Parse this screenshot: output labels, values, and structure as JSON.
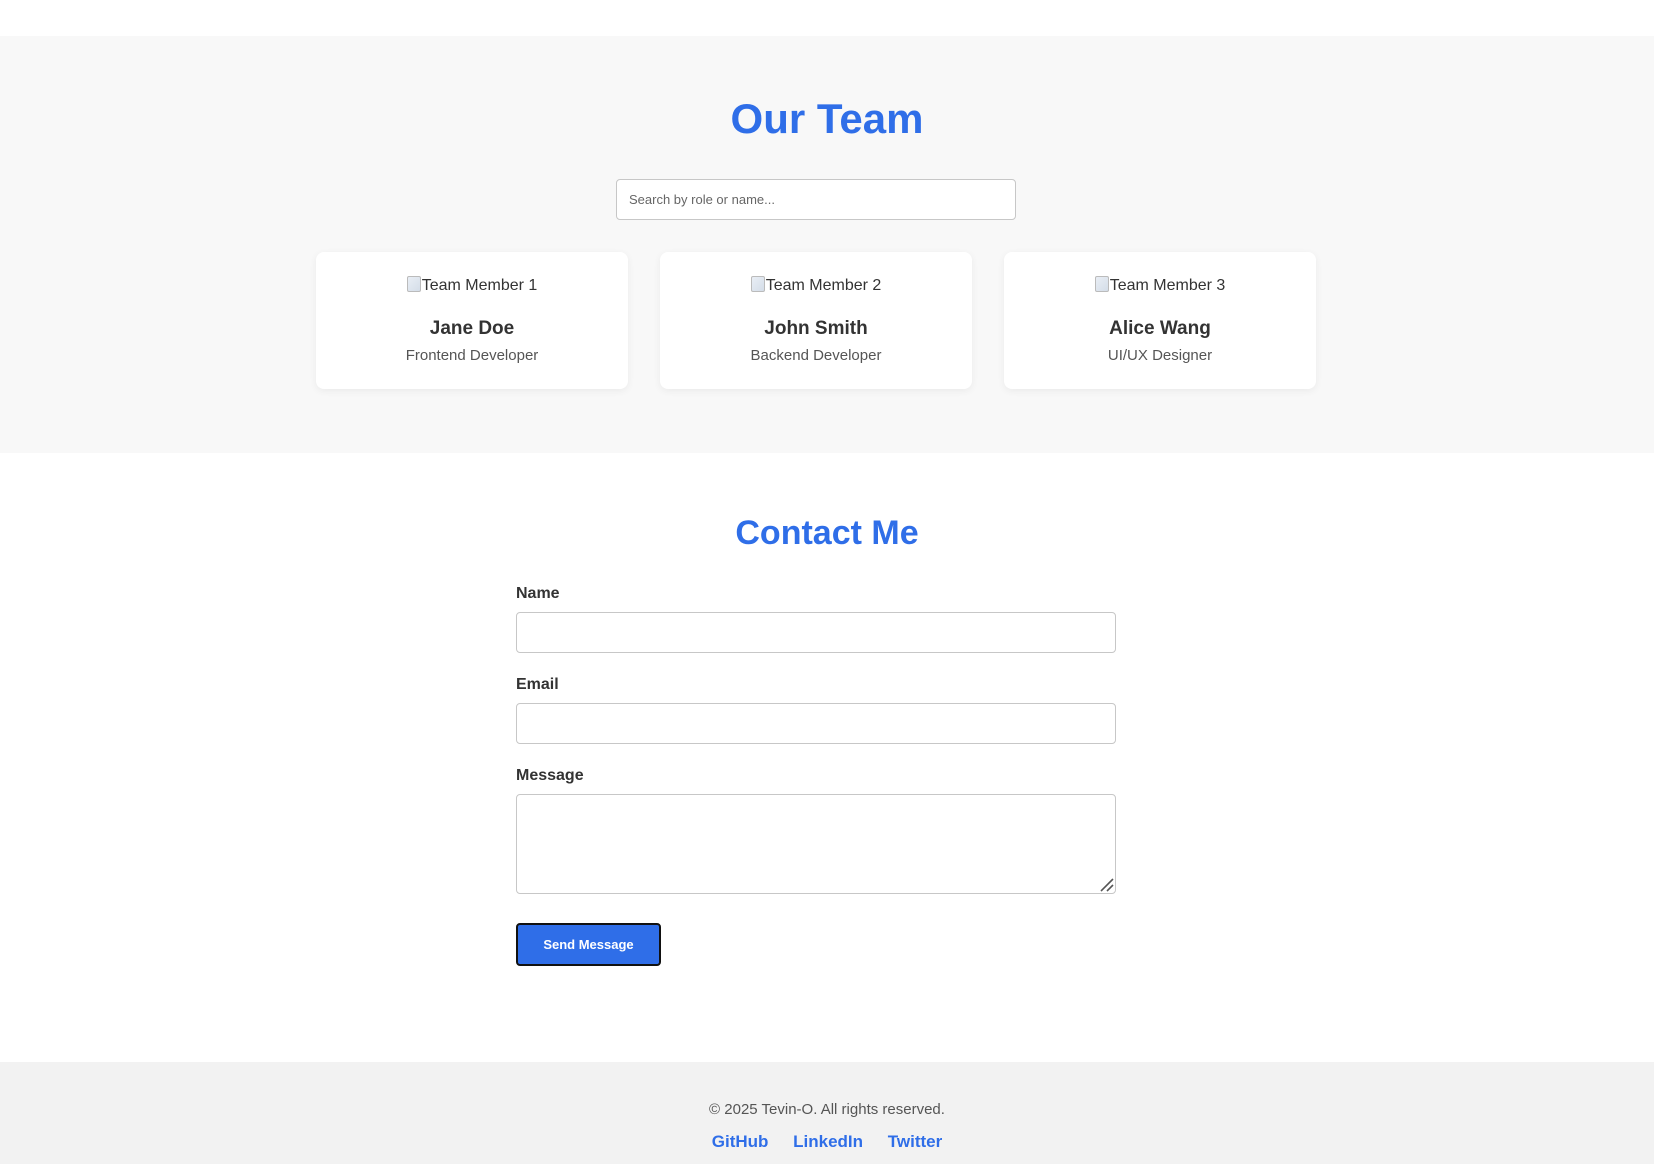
{
  "team": {
    "title": "Our Team",
    "search_placeholder": "Search by role or name...",
    "members": [
      {
        "image_alt": "Team Member 1",
        "name": "Jane Doe",
        "role": "Frontend Developer"
      },
      {
        "image_alt": "Team Member 2",
        "name": "John Smith",
        "role": "Backend Developer"
      },
      {
        "image_alt": "Team Member 3",
        "name": "Alice Wang",
        "role": "UI/UX Designer"
      }
    ]
  },
  "contact": {
    "title": "Contact Me",
    "name_label": "Name",
    "name_value": "",
    "email_label": "Email",
    "email_value": "",
    "message_label": "Message",
    "message_value": "",
    "submit_label": "Send Message"
  },
  "footer": {
    "copyright": "© 2025 Tevin-O. All rights reserved.",
    "links": [
      "GitHub",
      "LinkedIn",
      "Twitter"
    ]
  },
  "colors": {
    "accent": "#2f6ee8",
    "team_background": "#f8f8f8",
    "footer_background": "#f2f2f2"
  },
  "icons": {
    "broken_image": "broken-image-icon",
    "resize": "resize-handle-icon"
  }
}
